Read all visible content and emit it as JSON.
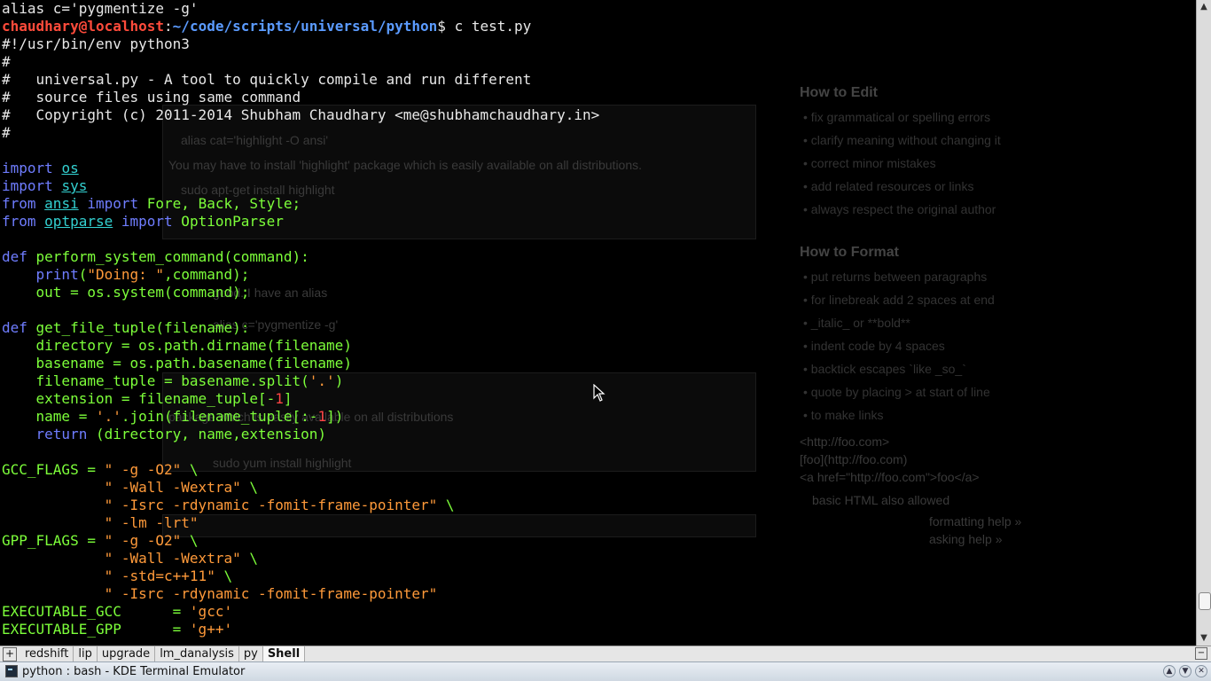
{
  "terminal": {
    "lines": [
      [
        {
          "t": "alias c='pygmentize -g'",
          "c": "plain"
        }
      ],
      [
        {
          "t": "chaudhary@localhost",
          "c": "prompt-user"
        },
        {
          "t": ":",
          "c": "plain"
        },
        {
          "t": "~/code/scripts/universal/python",
          "c": "prompt-path"
        },
        {
          "t": "$ c test.py",
          "c": "plain"
        }
      ],
      [
        {
          "t": "#!/usr/bin/env python3",
          "c": "comment"
        }
      ],
      [
        {
          "t": "#",
          "c": "comment"
        }
      ],
      [
        {
          "t": "#   universal.py - A tool to quickly compile and run different",
          "c": "comment"
        }
      ],
      [
        {
          "t": "#   source files using same command",
          "c": "comment"
        }
      ],
      [
        {
          "t": "#   Copyright (c) 2011-2014 Shubham Chaudhary <me@shubhamchaudhary.in>",
          "c": "comment"
        }
      ],
      [
        {
          "t": "#",
          "c": "comment"
        }
      ],
      [],
      [
        {
          "t": "import",
          "c": "kw"
        },
        {
          "t": " ",
          "c": "plain"
        },
        {
          "t": "os",
          "c": "mod"
        }
      ],
      [
        {
          "t": "import",
          "c": "kw"
        },
        {
          "t": " ",
          "c": "plain"
        },
        {
          "t": "sys",
          "c": "mod"
        }
      ],
      [
        {
          "t": "from",
          "c": "kw"
        },
        {
          "t": " ",
          "c": "plain"
        },
        {
          "t": "ansi",
          "c": "mod"
        },
        {
          "t": " ",
          "c": "plain"
        },
        {
          "t": "import",
          "c": "kw"
        },
        {
          "t": " Fore, Back, Style;",
          "c": "code"
        }
      ],
      [
        {
          "t": "from",
          "c": "kw"
        },
        {
          "t": " ",
          "c": "plain"
        },
        {
          "t": "optparse",
          "c": "mod"
        },
        {
          "t": " ",
          "c": "plain"
        },
        {
          "t": "import",
          "c": "kw"
        },
        {
          "t": " OptionParser",
          "c": "code"
        }
      ],
      [],
      [
        {
          "t": "def",
          "c": "kw"
        },
        {
          "t": " perform_system_command(command):",
          "c": "fn"
        }
      ],
      [
        {
          "t": "    ",
          "c": "plain"
        },
        {
          "t": "print",
          "c": "kw"
        },
        {
          "t": "(",
          "c": "code"
        },
        {
          "t": "\"Doing: \"",
          "c": "str"
        },
        {
          "t": ",command);",
          "c": "code"
        }
      ],
      [
        {
          "t": "    out = os.system(command);",
          "c": "code"
        }
      ],
      [],
      [
        {
          "t": "def",
          "c": "kw"
        },
        {
          "t": " get_file_tuple(filename):",
          "c": "fn"
        }
      ],
      [
        {
          "t": "    directory = os.path.dirname(filename)",
          "c": "code"
        }
      ],
      [
        {
          "t": "    basename = os.path.basename(filename)",
          "c": "code"
        }
      ],
      [
        {
          "t": "    filename_tuple = basename.split(",
          "c": "code"
        },
        {
          "t": "'.'",
          "c": "str"
        },
        {
          "t": ")",
          "c": "code"
        }
      ],
      [
        {
          "t": "    extension = filename_tuple[-",
          "c": "code"
        },
        {
          "t": "1",
          "c": "num"
        },
        {
          "t": "]",
          "c": "code"
        }
      ],
      [
        {
          "t": "    name = ",
          "c": "code"
        },
        {
          "t": "'.'",
          "c": "str"
        },
        {
          "t": ".join(filename_tuple[:-",
          "c": "code"
        },
        {
          "t": "1",
          "c": "num"
        },
        {
          "t": "])",
          "c": "code"
        }
      ],
      [
        {
          "t": "    ",
          "c": "plain"
        },
        {
          "t": "return",
          "c": "kw"
        },
        {
          "t": " (directory, name,extension)",
          "c": "code"
        }
      ],
      [],
      [
        {
          "t": "GCC_FLAGS = ",
          "c": "code"
        },
        {
          "t": "\" -g -O2\"",
          "c": "str"
        },
        {
          "t": " \\",
          "c": "code"
        }
      ],
      [
        {
          "t": "            ",
          "c": "plain"
        },
        {
          "t": "\" -Wall -Wextra\"",
          "c": "str"
        },
        {
          "t": " \\",
          "c": "code"
        }
      ],
      [
        {
          "t": "            ",
          "c": "plain"
        },
        {
          "t": "\" -Isrc -rdynamic -fomit-frame-pointer\"",
          "c": "str"
        },
        {
          "t": " \\",
          "c": "code"
        }
      ],
      [
        {
          "t": "            ",
          "c": "plain"
        },
        {
          "t": "\" -lm -lrt\"",
          "c": "str"
        }
      ],
      [
        {
          "t": "GPP_FLAGS = ",
          "c": "code"
        },
        {
          "t": "\" -g -O2\"",
          "c": "str"
        },
        {
          "t": " \\",
          "c": "code"
        }
      ],
      [
        {
          "t": "            ",
          "c": "plain"
        },
        {
          "t": "\" -Wall -Wextra\"",
          "c": "str"
        },
        {
          "t": " \\",
          "c": "code"
        }
      ],
      [
        {
          "t": "            ",
          "c": "plain"
        },
        {
          "t": "\" -std=c++11\"",
          "c": "str"
        },
        {
          "t": " \\",
          "c": "code"
        }
      ],
      [
        {
          "t": "            ",
          "c": "plain"
        },
        {
          "t": "\" -Isrc -rdynamic -fomit-frame-pointer\"",
          "c": "str"
        }
      ],
      [
        {
          "t": "EXECUTABLE_GCC      = ",
          "c": "code"
        },
        {
          "t": "'gcc'",
          "c": "str"
        }
      ],
      [
        {
          "t": "EXECUTABLE_GPP      = ",
          "c": "code"
        },
        {
          "t": "'g++'",
          "c": "str"
        }
      ]
    ]
  },
  "tabbar": {
    "tabs": [
      {
        "label": "redshift",
        "active": false
      },
      {
        "label": "lip",
        "active": false
      },
      {
        "label": "upgrade",
        "active": false
      },
      {
        "label": "lm_danalysis",
        "active": false
      },
      {
        "label": "py",
        "active": false
      },
      {
        "label": "Shell",
        "active": true
      }
    ]
  },
  "window": {
    "title": "python : bash - KDE Terminal Emulator"
  },
  "ghost": {
    "how_to_edit": "How to Edit",
    "how_to_format": "How to Format",
    "edit_items": [
      "fix grammatical or spelling errors",
      "clarify meaning without changing it",
      "correct minor mistakes",
      "add related resources or links",
      "always respect the original author"
    ],
    "format_items": [
      "put returns between paragraphs",
      "for linebreak add 2 spaces at end",
      "_italic_ or **bold**",
      "indent code by 4 spaces",
      "backtick escapes `like _so_`",
      "quote by placing > at start of line",
      "to make links"
    ],
    "snippets": [
      "alias cat='highlight -O ansi'",
      "You may have to install 'highlight' package which is easily available on all distributions.",
      "sudo apt-get install highlight",
      "good. I have an alias",
      "alias c='pygmentize -g'",
      "package which is easily available on all distributions",
      "sudo yum install highlight",
      "<http://foo.com>",
      "[foo](http://foo.com)",
      "<a href=\"http://foo.com\">foo</a>",
      "basic HTML also allowed",
      "formatting help »",
      "asking help »"
    ]
  },
  "colors": {
    "prompt_user": "#ff4b3b",
    "prompt_path": "#5b9bff",
    "keyword": "#6f7dff",
    "module": "#33d1d1",
    "code": "#7dff3a",
    "string": "#ff9a3a",
    "number": "#ff4444"
  }
}
